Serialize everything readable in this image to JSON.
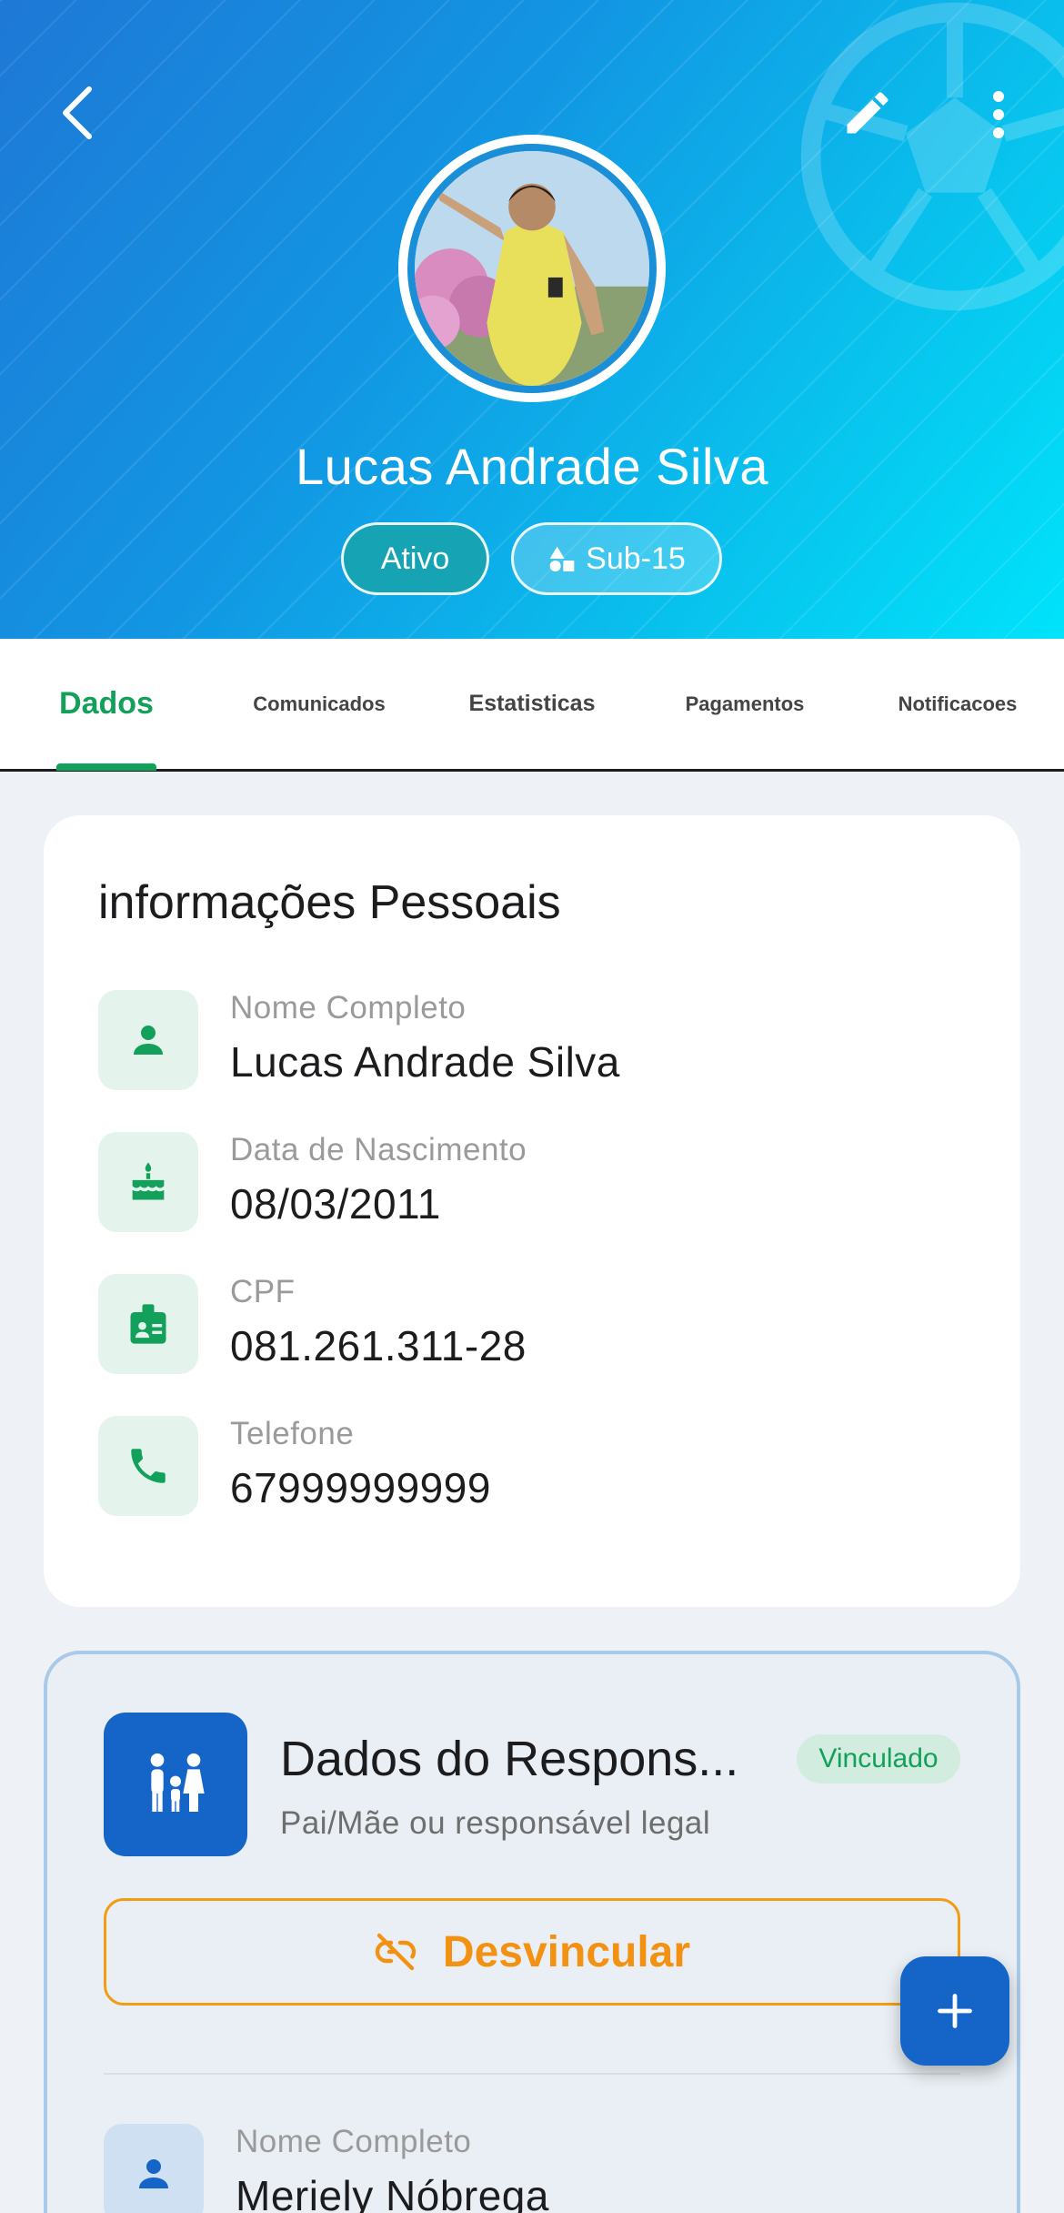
{
  "header": {
    "player_name": "Lucas Andrade Silva",
    "status_badge": "Ativo",
    "category_badge": "Sub-15",
    "icons": {
      "back": "back-arrow-icon",
      "edit": "pencil-icon",
      "more": "more-vert-icon",
      "watermark": "soccer-ball-icon",
      "category": "shapes-icon"
    }
  },
  "tabs": [
    {
      "label": "Dados",
      "active": true
    },
    {
      "label": "Comunicados",
      "active": false
    },
    {
      "label": "Estatisticas",
      "active": false
    },
    {
      "label": "Pagamentos",
      "active": false
    },
    {
      "label": "Notificacoes",
      "active": false
    }
  ],
  "personal_info": {
    "title": "informações Pessoais",
    "rows": [
      {
        "label": "Nome Completo",
        "value": "Lucas Andrade Silva",
        "icon": "person-icon"
      },
      {
        "label": "Data de Nascimento",
        "value": "08/03/2011",
        "icon": "cake-icon"
      },
      {
        "label": "CPF",
        "value": "081.261.311-28",
        "icon": "id-badge-icon"
      },
      {
        "label": "Telefone",
        "value": "67999999999",
        "icon": "phone-icon"
      }
    ]
  },
  "guardian": {
    "title": "Dados do Respons...",
    "badge": "Vinculado",
    "subtitle": "Pai/Mãe ou responsável legal",
    "unlink_label": "Desvincular",
    "row": {
      "label": "Nome Completo",
      "value": "Meriely Nóbrega",
      "icon": "person-icon"
    },
    "icon": "family-icon"
  },
  "fab": {
    "icon": "plus-icon"
  },
  "colors": {
    "accent_green": "#12a05a",
    "brand_blue": "#1565c9",
    "warning_orange": "#f39212",
    "header_gradient_start": "#1e78d6",
    "header_gradient_end": "#00e3fb"
  }
}
